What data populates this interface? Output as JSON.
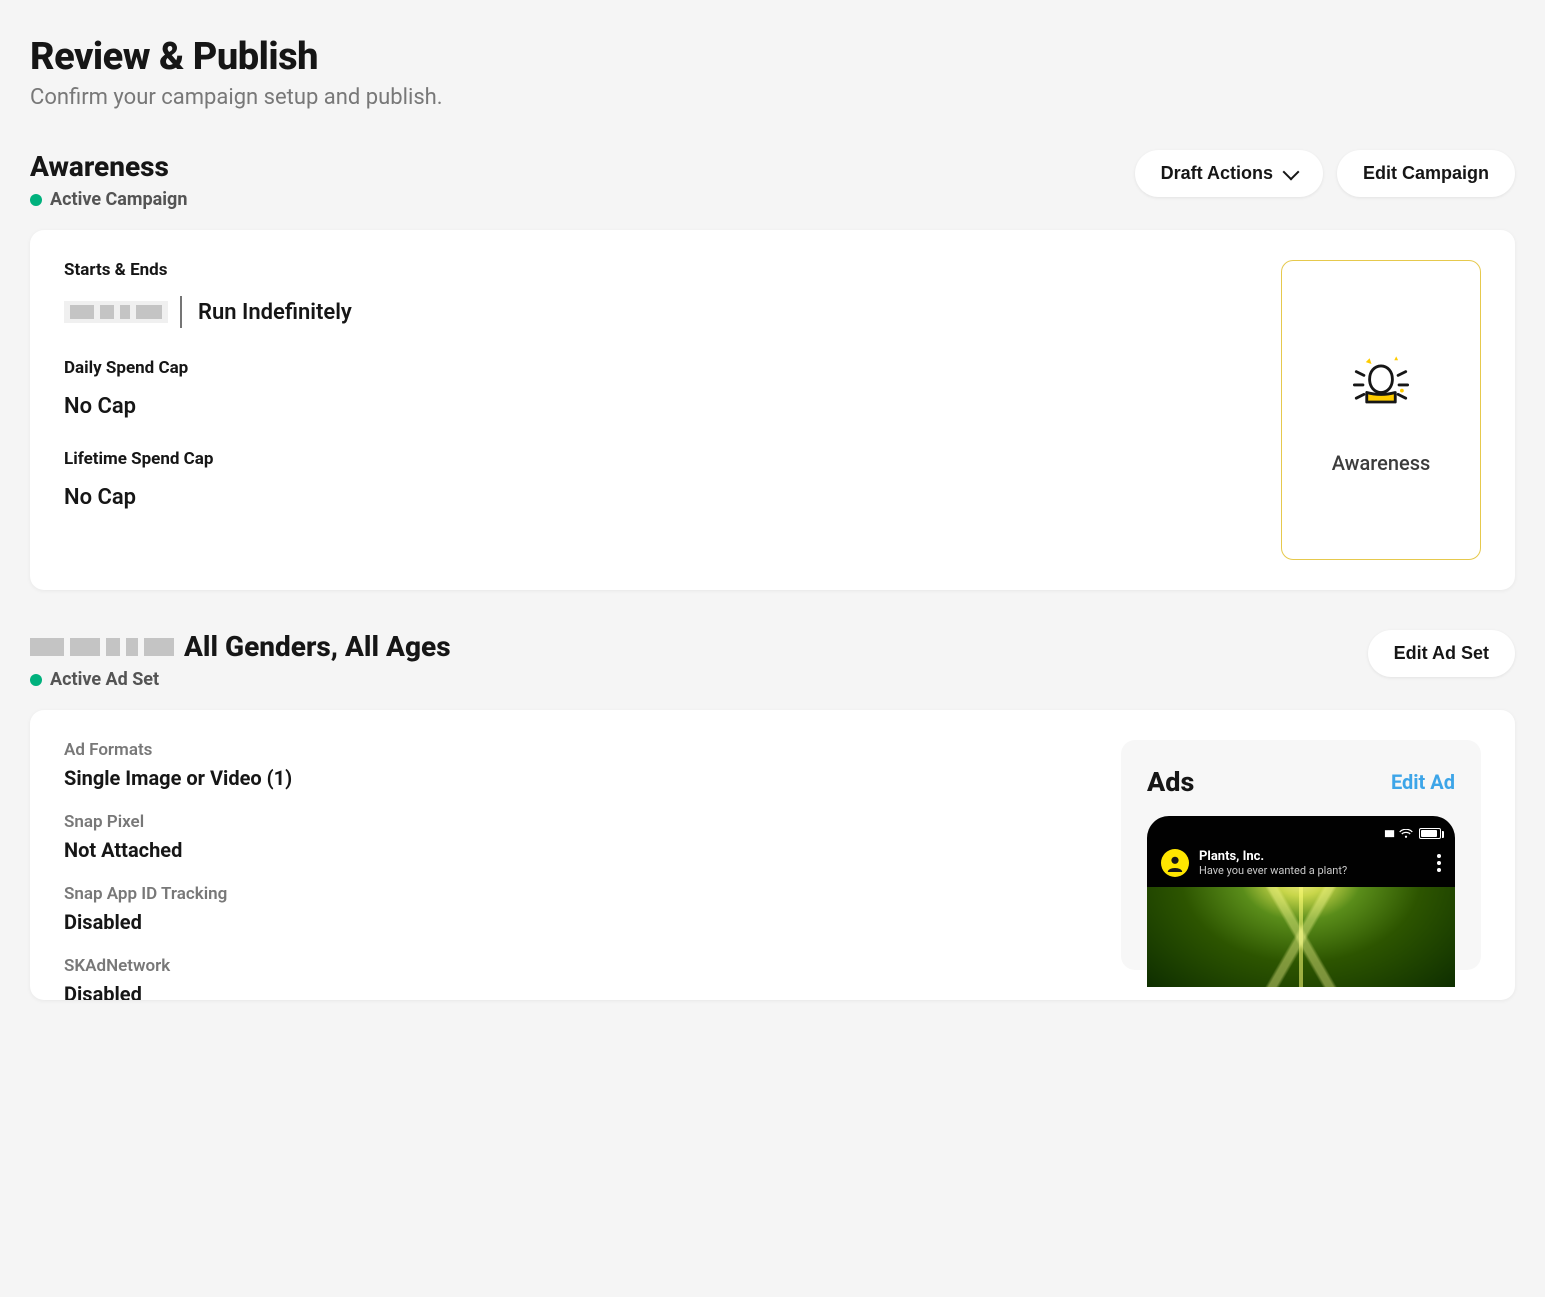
{
  "page": {
    "title": "Review & Publish",
    "subtitle": "Confirm your campaign setup and publish."
  },
  "campaign": {
    "name": "Awareness",
    "status": "Active Campaign",
    "draft_actions_label": "Draft Actions",
    "edit_label": "Edit Campaign",
    "starts_ends_label": "Starts & Ends",
    "starts_ends_value": "Run Indefinitely",
    "daily_cap_label": "Daily Spend Cap",
    "daily_cap_value": "No Cap",
    "lifetime_cap_label": "Lifetime Spend Cap",
    "lifetime_cap_value": "No Cap",
    "objective_card_label": "Awareness"
  },
  "adset": {
    "title": "All Genders, All Ages",
    "status": "Active Ad Set",
    "edit_label": "Edit Ad Set",
    "formats_label": "Ad Formats",
    "formats_value": "Single Image or Video (1)",
    "pixel_label": "Snap Pixel",
    "pixel_value": "Not Attached",
    "app_id_label": "Snap App ID Tracking",
    "app_id_value": "Disabled",
    "skad_label": "SKAdNetwork",
    "skad_value": "Disabled"
  },
  "ads_panel": {
    "title": "Ads",
    "edit_label": "Edit Ad",
    "preview": {
      "brand": "Plants, Inc.",
      "tagline": "Have you ever wanted a plant?"
    }
  }
}
